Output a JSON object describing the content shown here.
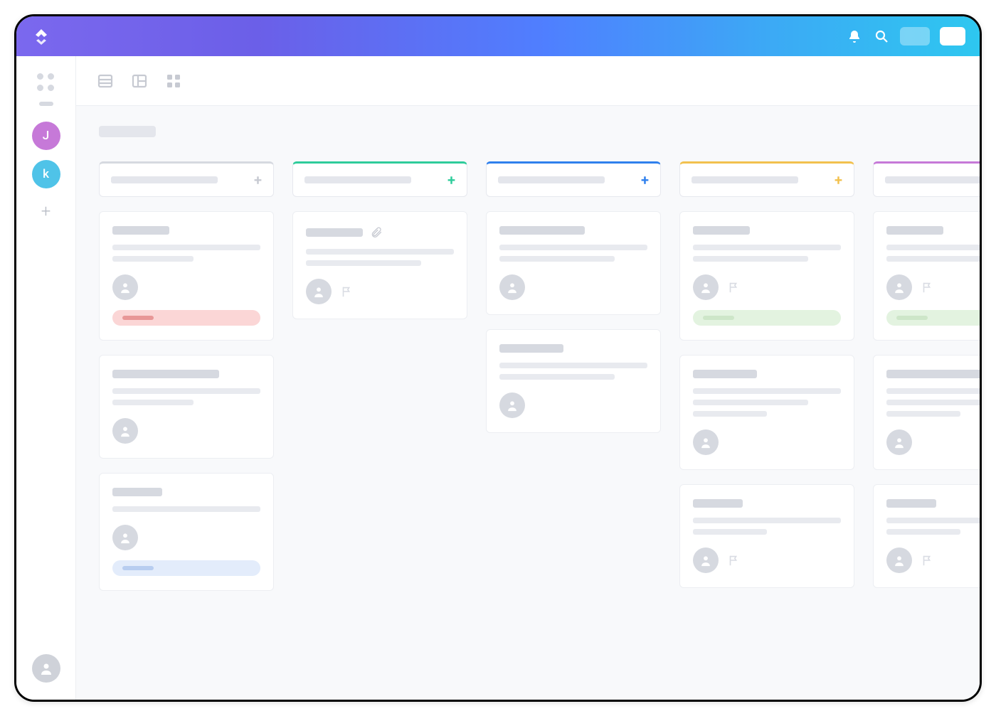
{
  "sidebar": {
    "workspaces": [
      {
        "initial": "J",
        "color": "purple"
      },
      {
        "initial": "k",
        "color": "blue"
      }
    ],
    "add_label": "+"
  },
  "topbar": {
    "notification_label": "Notifications",
    "search_label": "Search"
  },
  "toolbar": {
    "views": [
      "list",
      "board",
      "grid"
    ]
  },
  "board": {
    "breadcrumb": "",
    "columns": [
      {
        "id": "col-gray",
        "accent": "#d6d9e0",
        "plus_accent": "#c7cad2",
        "title": "",
        "cards": [
          {
            "title_w": 80,
            "lines": [
              1,
              0.55
            ],
            "has_attachment": false,
            "has_flag": false,
            "tag": "red"
          },
          {
            "title_w": 150,
            "lines": [
              1,
              0.55
            ],
            "has_attachment": false,
            "has_flag": false,
            "tag": null
          },
          {
            "title_w": 70,
            "lines": [
              1
            ],
            "has_attachment": false,
            "has_flag": false,
            "tag": "blue"
          }
        ]
      },
      {
        "id": "col-teal",
        "accent": "#2ecc9b",
        "title": "",
        "cards": [
          {
            "title_w": 80,
            "lines": [
              1,
              0.78
            ],
            "has_attachment": true,
            "has_flag": true,
            "tag": null
          }
        ]
      },
      {
        "id": "col-blue",
        "accent": "#2f80ed",
        "title": "",
        "cards": [
          {
            "title_w": 120,
            "lines": [
              1,
              0.78
            ],
            "has_attachment": false,
            "has_flag": false,
            "tag": null
          },
          {
            "title_w": 90,
            "lines": [
              1,
              0.78
            ],
            "has_attachment": false,
            "has_flag": false,
            "tag": null
          }
        ]
      },
      {
        "id": "col-yellow",
        "accent": "#f2c14e",
        "title": "",
        "cards": [
          {
            "title_w": 80,
            "lines": [
              1,
              0.78
            ],
            "has_attachment": false,
            "has_flag": true,
            "tag": "green"
          },
          {
            "title_w": 90,
            "lines": [
              1,
              0.78,
              0.5
            ],
            "has_attachment": false,
            "has_flag": false,
            "tag": null
          },
          {
            "title_w": 70,
            "lines": [
              1,
              0.5
            ],
            "has_attachment": false,
            "has_flag": true,
            "tag": null
          }
        ]
      },
      {
        "id": "col-purple",
        "accent": "#c679d8",
        "title": "",
        "cards": [
          {
            "title_w": 80,
            "lines": [
              1,
              0.78
            ],
            "has_attachment": false,
            "has_flag": true,
            "tag": "green"
          },
          {
            "title_w": 150,
            "lines": [
              1,
              0.78,
              0.5
            ],
            "has_attachment": false,
            "has_flag": false,
            "tag": null
          },
          {
            "title_w": 70,
            "lines": [
              1,
              0.5
            ],
            "has_attachment": false,
            "has_flag": true,
            "tag": null
          }
        ]
      }
    ]
  }
}
